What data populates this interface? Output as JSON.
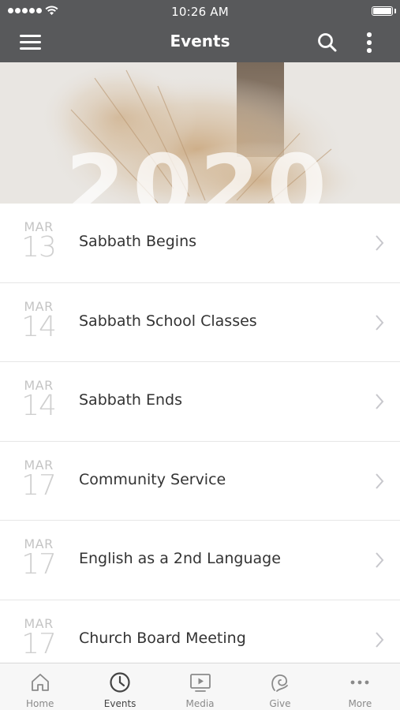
{
  "status_bar": {
    "time": "10:26 AM"
  },
  "header": {
    "title": "Events",
    "icons": [
      "menu-icon",
      "search-icon",
      "more-vertical-icon"
    ]
  },
  "banner": {
    "text": "2020"
  },
  "events": [
    {
      "month": "MAR",
      "day": "13",
      "title": "Sabbath Begins"
    },
    {
      "month": "MAR",
      "day": "14",
      "title": "Sabbath School Classes"
    },
    {
      "month": "MAR",
      "day": "14",
      "title": "Sabbath Ends"
    },
    {
      "month": "MAR",
      "day": "17",
      "title": "Community Service"
    },
    {
      "month": "MAR",
      "day": "17",
      "title": "English as a 2nd Language"
    },
    {
      "month": "MAR",
      "day": "17",
      "title": "Church Board Meeting"
    }
  ],
  "tabs": [
    {
      "label": "Home",
      "icon": "home-icon",
      "active": false
    },
    {
      "label": "Events",
      "icon": "clock-icon",
      "active": true
    },
    {
      "label": "Media",
      "icon": "play-screen-icon",
      "active": false
    },
    {
      "label": "Give",
      "icon": "give-icon",
      "active": false
    },
    {
      "label": "More",
      "icon": "more-horizontal-icon",
      "active": false
    }
  ],
  "colors": {
    "header_bg": "#58595b",
    "tab_active": "#444444",
    "tab_inactive": "#8a8a8a"
  }
}
